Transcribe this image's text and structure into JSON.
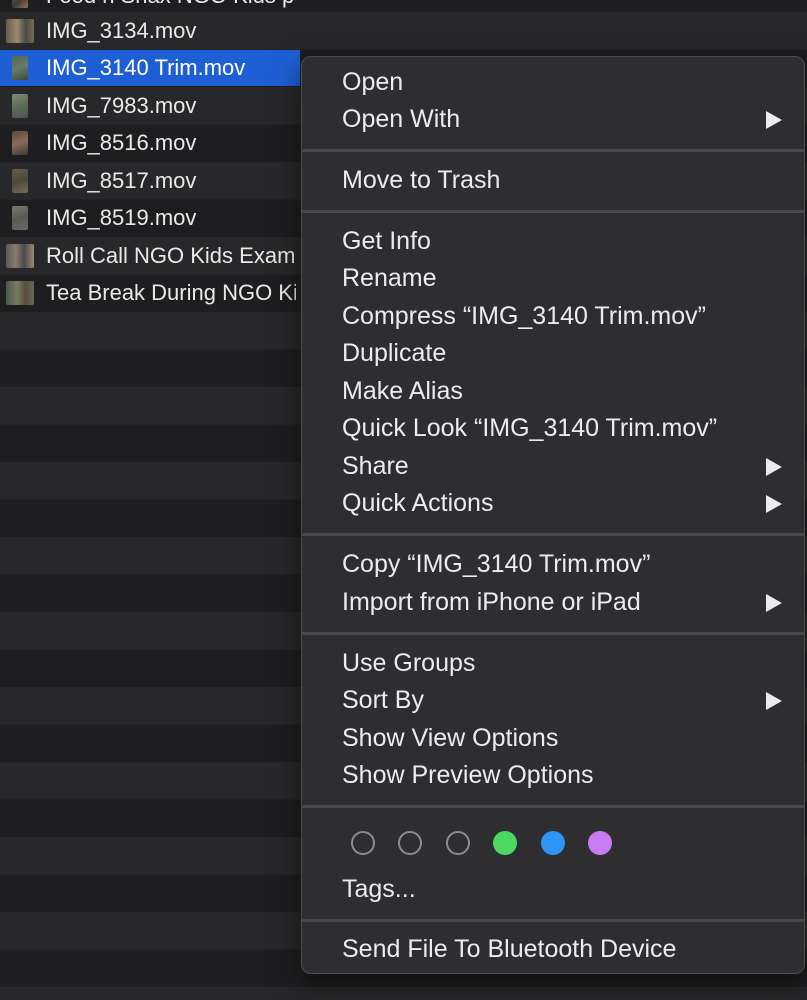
{
  "files": [
    {
      "name": "Food n Snax NGO Kids post Exam.mov",
      "thumb": "portrait-icon",
      "selected": false
    },
    {
      "name": "IMG_3134.mov",
      "thumb": "landscape-icon",
      "selected": false
    },
    {
      "name": "IMG_3140 Trim.mov",
      "thumb": "portrait-icon",
      "selected": true
    },
    {
      "name": "IMG_7983.mov",
      "thumb": "portrait-icon",
      "selected": false
    },
    {
      "name": "IMG_8516.mov",
      "thumb": "portrait-icon",
      "selected": false
    },
    {
      "name": "IMG_8517.mov",
      "thumb": "portrait-icon",
      "selected": false
    },
    {
      "name": "IMG_8519.mov",
      "thumb": "portrait-icon",
      "selected": false
    },
    {
      "name": "Roll Call NGO Kids Exam.mov",
      "thumb": "landscape-icon",
      "selected": false
    },
    {
      "name": "Tea Break During NGO Kids Exam.mov",
      "thumb": "landscape-icon",
      "selected": false
    }
  ],
  "menu": {
    "open": "Open",
    "open_with": "Open With",
    "move_to_trash": "Move to Trash",
    "get_info": "Get Info",
    "rename": "Rename",
    "compress": "Compress “IMG_3140 Trim.mov”",
    "duplicate": "Duplicate",
    "make_alias": "Make Alias",
    "quick_look": "Quick Look “IMG_3140 Trim.mov”",
    "share": "Share",
    "quick_actions": "Quick Actions",
    "copy": "Copy “IMG_3140 Trim.mov”",
    "import_from": "Import from iPhone or iPad",
    "use_groups": "Use Groups",
    "sort_by": "Sort By",
    "show_view_options": "Show View Options",
    "show_preview_options": "Show Preview Options",
    "tags": "Tags...",
    "send_bluetooth": "Send File To Bluetooth Device"
  },
  "tag_colors": [
    "none",
    "none",
    "none",
    "#4bd962",
    "#2f94f7",
    "#c77df1"
  ],
  "colors": {
    "selection": "#1f5fd6",
    "menu_bg": "#2e2e30"
  }
}
